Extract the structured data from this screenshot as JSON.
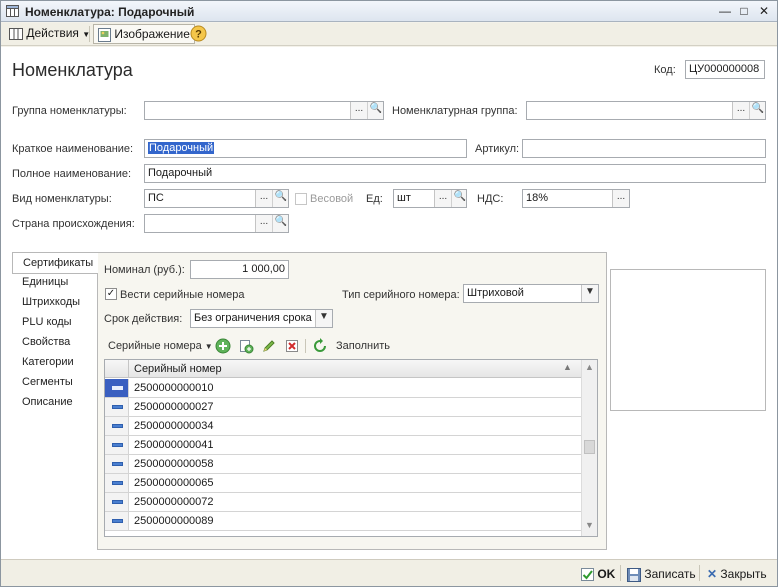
{
  "window": {
    "title": "Номенклатура: Подарочный"
  },
  "toolbar": {
    "actions_label": "Действия",
    "image_label": "Изображение"
  },
  "form": {
    "heading": "Номенклатура",
    "code_label": "Код:",
    "code_value": "ЦУ000000008",
    "group_label": "Группа номенклатуры:",
    "group_value": "",
    "nom_group_label": "Номенклатурная группа:",
    "nom_group_value": "",
    "short_name_label": "Краткое наименование:",
    "short_name_value": "Подарочный",
    "article_label": "Артикул:",
    "article_value": "",
    "full_name_label": "Полное наименование:",
    "full_name_value": "Подарочный",
    "kind_label": "Вид номенклатуры:",
    "kind_value": "ПС",
    "weight_label": "Весовой",
    "unit_label": "Ед:",
    "unit_value": "шт",
    "vat_label": "НДС:",
    "vat_value": "18%",
    "country_label": "Страна происхождения:",
    "country_value": ""
  },
  "tabs": [
    {
      "label": "Сертификаты"
    },
    {
      "label": "Единицы"
    },
    {
      "label": "Штрихкоды"
    },
    {
      "label": "PLU коды"
    },
    {
      "label": "Свойства"
    },
    {
      "label": "Категории"
    },
    {
      "label": "Сегменты"
    },
    {
      "label": "Описание"
    }
  ],
  "certificates": {
    "nominal_label": "Номинал (руб.):",
    "nominal_value": "1 000,00",
    "serial_check_label": "Вести серийные номера",
    "serial_type_label": "Тип серийного номера:",
    "serial_type_value": "Штриховой",
    "validity_label": "Срок действия:",
    "validity_value": "Без ограничения срока",
    "serials_menu_label": "Серийные номера",
    "fill_label": "Заполнить",
    "column_header": "Серийный номер",
    "rows": [
      "2500000000010",
      "2500000000027",
      "2500000000034",
      "2500000000041",
      "2500000000058",
      "2500000000065",
      "2500000000072",
      "2500000000089"
    ]
  },
  "footer": {
    "ok_label": "OK",
    "save_label": "Записать",
    "close_label": "Закрыть"
  }
}
